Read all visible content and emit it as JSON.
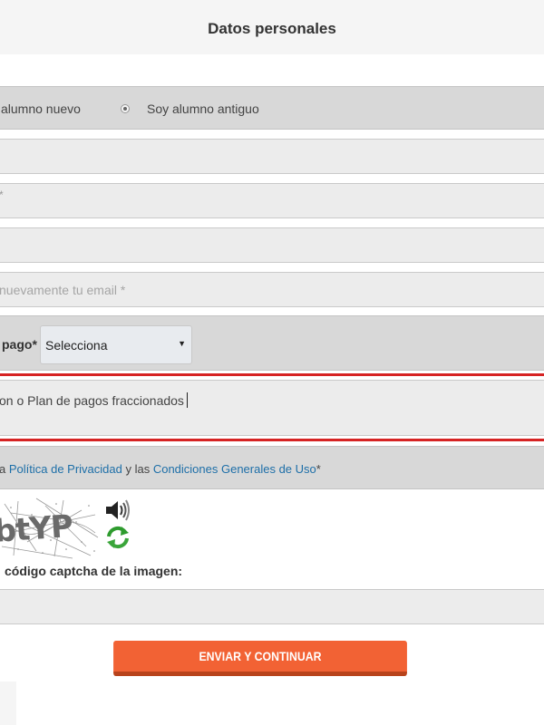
{
  "header": {
    "title": "Datos personales"
  },
  "radio": {
    "option_new": "alumno nuevo",
    "option_old": "Soy alumno antiguo"
  },
  "fields": {
    "field2_visible_char": "*",
    "email_confirm_placeholder": "nuevamente tu email *"
  },
  "payment": {
    "label": "pago*",
    "select_value": "Selecciona",
    "arrow": "▼"
  },
  "plan": {
    "text": "on o Plan de pagos fraccionados"
  },
  "privacy": {
    "prefix": "a ",
    "privacy_link": "Política de Privacidad",
    "middle": " y las ",
    "conditions_link": "Condiciones Generales de Uso",
    "suffix": "*"
  },
  "captcha": {
    "image_text": "btYP",
    "label": "código captcha de la imagen:",
    "sound_icon": "speaker-icon",
    "refresh_icon": "refresh-icon"
  },
  "submit": {
    "label": "ENVIAR Y CONTINUAR"
  },
  "colors": {
    "accent": "#f26234",
    "link": "#1e6fa8",
    "error": "#d62323"
  }
}
